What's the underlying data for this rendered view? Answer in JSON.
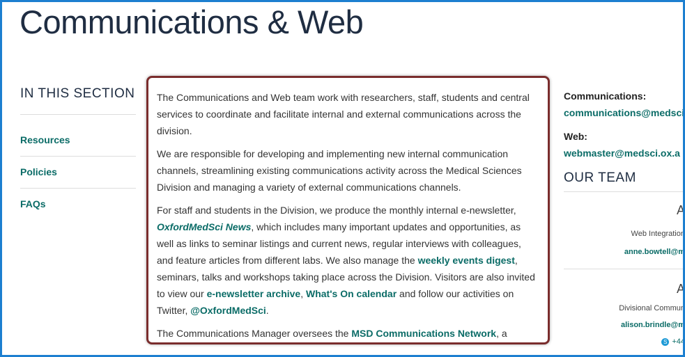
{
  "header": {
    "title": "Communications & Web"
  },
  "sidebar": {
    "heading": "IN THIS SECTION",
    "items": [
      {
        "label": "Resources"
      },
      {
        "label": "Policies"
      },
      {
        "label": "FAQs"
      }
    ]
  },
  "main": {
    "p1": "The Communications and Web team work with researchers, staff, students and central services to coordinate and facilitate internal and external communications across the division.",
    "p2": "We are responsible for developing and implementing new internal communication channels, streamlining existing communications activity across the Medical Sciences Division and managing a variety of external communications channels.",
    "p3": {
      "t1": "For staff and students in the Division, we produce the monthly internal e-newsletter, ",
      "link1": "OxfordMedSci News",
      "t2": ", which includes many important updates and opportunities, as well as links to seminar listings and current news, regular interviews with colleagues, and feature articles from different labs.  We also manage the ",
      "link2": "weekly events digest",
      "t3": ", seminars, talks and workshops taking place across the Division. Visitors are also invited to view our ",
      "link3": "e-newsletter archive",
      "t4": ", ",
      "link4": "What's On calendar",
      "t5": " and follow our activities on Twitter, ",
      "link5": "@OxfordMedSci",
      "t6": "."
    },
    "p4": {
      "t1": "The Communications Manager oversees the ",
      "link1": "MSD Communications Network",
      "t2": ", a network of staff in communication-related roles in the Division. The network provides"
    }
  },
  "contact": {
    "comms_label": "Communications:",
    "comms_email": "communications@medsci",
    "web_label": "Web:",
    "web_email": "webmaster@medsci.ox.a"
  },
  "team": {
    "heading": "OUR TEAM",
    "members": [
      {
        "initial": "A",
        "role": "Web Integration",
        "email": "anne.bowtell@m"
      },
      {
        "initial": "A",
        "role": "Divisional Commun",
        "email": "alison.brindle@m",
        "phone": "+44"
      }
    ]
  },
  "colors": {
    "link": "#0b6c67",
    "heading": "#1f2d42",
    "frame": "#1c7fd0",
    "highlight_border": "#7a2d2d"
  }
}
